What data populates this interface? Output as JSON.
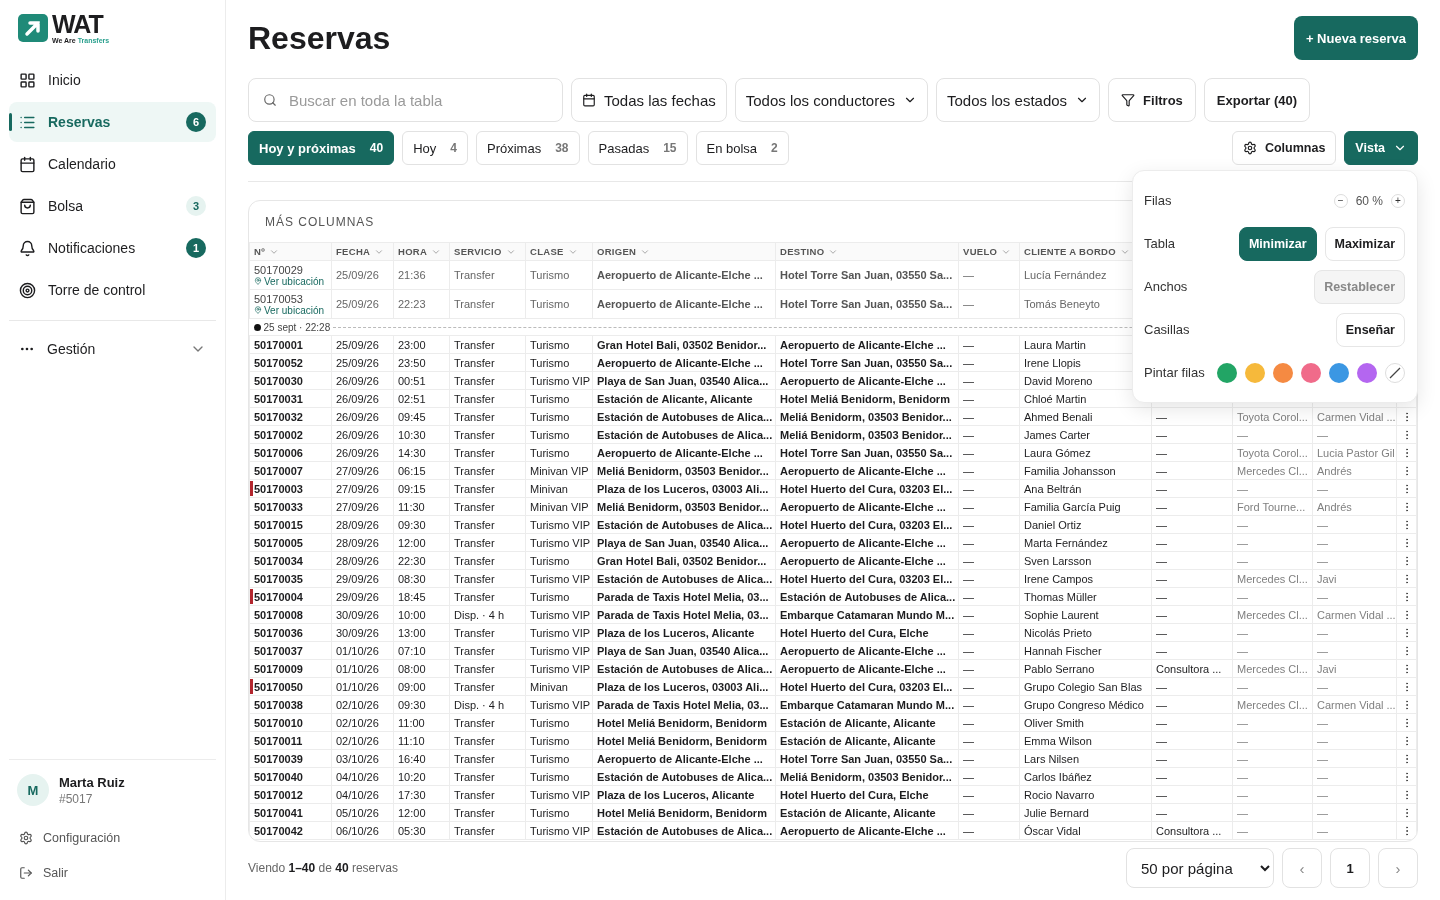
{
  "logo": {
    "name": "WAT",
    "tagline": "We Are",
    "tagline_accent": "Transfers"
  },
  "sidebar": {
    "items": [
      {
        "label": "Inicio",
        "selected": false
      },
      {
        "label": "Reservas",
        "selected": true,
        "badge": "6",
        "badge_highlighted": true
      },
      {
        "label": "Calendario",
        "selected": false
      },
      {
        "label": "Bolsa",
        "selected": false,
        "badge": "3",
        "badge_highlighted": false
      },
      {
        "label": "Notificaciones",
        "selected": false,
        "badge": "1",
        "badge_highlighted": true
      },
      {
        "label": "Torre de control",
        "selected": false
      }
    ],
    "section": {
      "label": "Gestión",
      "expanded": false
    },
    "user": {
      "initial": "M",
      "name": "Marta Ruiz",
      "id": "#5017"
    },
    "footer_links": [
      {
        "label": "Configuración"
      },
      {
        "label": "Salir"
      }
    ]
  },
  "title": "Reservas",
  "new_button": "+ Nueva reserva",
  "filters": {
    "search": {
      "placeholder": "Buscar en toda la tabla"
    },
    "dates": "Todas las fechas",
    "drivers": "Todos los conductores",
    "states": "Todos los estados",
    "more": "Filtros",
    "export": "Exportar (40)"
  },
  "tabs": [
    {
      "label": "Hoy y próximas",
      "count": "40",
      "selected": true
    },
    {
      "label": "Hoy",
      "count": "4",
      "selected": false
    },
    {
      "label": "Próximas",
      "count": "38",
      "selected": false
    },
    {
      "label": "Pasadas",
      "count": "15",
      "selected": false
    },
    {
      "label": "En bolsa",
      "count": "2",
      "selected": false
    }
  ],
  "columns_button": "Columnas",
  "view_button": "Vista",
  "view_panel": {
    "rows_label": "Filas",
    "minus": "−",
    "zoom": "60 %",
    "plus": "+",
    "table_label": "Tabla",
    "table_options": [
      {
        "label": "Minimizar",
        "selected": true
      },
      {
        "label": "Maximizar",
        "selected": false
      }
    ],
    "widths_label": "Anchos",
    "reset": "Restablecer",
    "reset_disabled": true,
    "boxes_label": "Casillas",
    "show": "Enseñar",
    "paint_label": "Pintar filas",
    "swatches": [
      {
        "kind": "color",
        "color": "#22a565"
      },
      {
        "kind": "color",
        "color": "#f6b93b"
      },
      {
        "kind": "color",
        "color": "#f58a42"
      },
      {
        "kind": "color",
        "color": "#f06b8a"
      },
      {
        "kind": "color",
        "color": "#3b97e3"
      },
      {
        "kind": "color",
        "color": "#b466f0"
      },
      {
        "kind": "none"
      }
    ]
  },
  "table": {
    "title": "MÁS COLUMNAS",
    "columns": [
      "Nº",
      "FECHA",
      "HORA",
      "SERVICIO",
      "CLASE",
      "ORIGEN",
      "DESTINO",
      "VUELO",
      "CLIENTE A BORDO"
    ],
    "pinned_rows": [
      {
        "cells": [
          "50170029",
          "25/09/26",
          "21:36",
          "Transfer",
          "Turismo",
          "Aeropuerto de Alicante-Elche ...",
          "Hotel Torre San Juan, 03550 Sa...",
          "—",
          "Lucía Fernández"
        ],
        "link": "Ver ubicación"
      },
      {
        "cells": [
          "50170053",
          "25/09/26",
          "22:23",
          "Transfer",
          "Turismo",
          "Aeropuerto de Alicante-Elche ...",
          "Hotel Torre San Juan, 03550 Sa...",
          "—",
          "Tomás Beneyto"
        ],
        "link": "Ver ubicación"
      }
    ],
    "now_marker": "25 sept · 22:28",
    "rows": [
      {
        "marked": false,
        "cells": [
          "50170001",
          "25/09/26",
          "23:00",
          "Transfer",
          "Turismo",
          "Gran Hotel Bali, 03502 Benidor...",
          "Aeropuerto de Alicante-Elche ...",
          "—",
          "Laura Martin"
        ]
      },
      {
        "marked": false,
        "cells": [
          "50170052",
          "25/09/26",
          "23:50",
          "Transfer",
          "Turismo",
          "Aeropuerto de Alicante-Elche ...",
          "Hotel Torre San Juan, 03550 Sa...",
          "—",
          "Irene Llopis"
        ]
      },
      {
        "marked": false,
        "cells": [
          "50170030",
          "26/09/26",
          "00:51",
          "Transfer",
          "Turismo VIP",
          "Playa de San Juan, 03540 Alica...",
          "Aeropuerto de Alicante-Elche ...",
          "—",
          "David Moreno"
        ]
      },
      {
        "marked": false,
        "cells": [
          "50170031",
          "26/09/26",
          "02:51",
          "Transfer",
          "Turismo",
          "Estación de Alicante, Alicante",
          "Hotel Meliá Benidorm, Benidorm",
          "—",
          "Chloé Martin"
        ]
      },
      {
        "marked": false,
        "cells": [
          "50170032",
          "26/09/26",
          "09:45",
          "Transfer",
          "Turismo",
          "Estación de Autobuses de Alica...",
          "Meliá Benidorm, 03503 Benidor...",
          "—",
          "Ahmed Benali"
        ],
        "extra": [
          "—",
          "Toyota Corol...",
          "Carmen Vidal ..."
        ]
      },
      {
        "marked": false,
        "cells": [
          "50170002",
          "26/09/26",
          "10:30",
          "Transfer",
          "Turismo",
          "Estación de Autobuses de Alica...",
          "Meliá Benidorm, 03503 Benidor...",
          "—",
          "James Carter"
        ],
        "extra": [
          "—",
          "—",
          "—"
        ]
      },
      {
        "marked": false,
        "cells": [
          "50170006",
          "26/09/26",
          "14:30",
          "Transfer",
          "Turismo",
          "Aeropuerto de Alicante-Elche ...",
          "Hotel Torre San Juan, 03550 Sa...",
          "—",
          "Laura Gómez"
        ],
        "extra": [
          "—",
          "Toyota Corol...",
          "Lucia Pastor Gil"
        ]
      },
      {
        "marked": false,
        "cells": [
          "50170007",
          "27/09/26",
          "06:15",
          "Transfer",
          "Minivan VIP",
          "Meliá Benidorm, 03503 Benidor...",
          "Aeropuerto de Alicante-Elche ...",
          "—",
          "Familia Johansson"
        ],
        "extra": [
          "—",
          "Mercedes Cl...",
          "Andrés"
        ]
      },
      {
        "marked": true,
        "cells": [
          "50170003",
          "27/09/26",
          "09:15",
          "Transfer",
          "Minivan",
          "Plaza de los Luceros, 03003 Ali...",
          "Hotel Huerto del Cura, 03203 El...",
          "—",
          "Ana Beltrán"
        ],
        "extra": [
          "—",
          "—",
          "—"
        ]
      },
      {
        "marked": false,
        "cells": [
          "50170033",
          "27/09/26",
          "11:30",
          "Transfer",
          "Minivan VIP",
          "Meliá Benidorm, 03503 Benidor...",
          "Aeropuerto de Alicante-Elche ...",
          "—",
          "Familia García Puig"
        ],
        "extra": [
          "—",
          "Ford Tourne...",
          "Andrés"
        ]
      },
      {
        "marked": false,
        "cells": [
          "50170015",
          "28/09/26",
          "09:30",
          "Transfer",
          "Turismo VIP",
          "Estación de Autobuses de Alica...",
          "Hotel Huerto del Cura, 03203 El...",
          "—",
          "Daniel Ortiz"
        ],
        "extra": [
          "—",
          "—",
          "—"
        ]
      },
      {
        "marked": false,
        "cells": [
          "50170005",
          "28/09/26",
          "12:00",
          "Transfer",
          "Turismo VIP",
          "Playa de San Juan, 03540 Alica...",
          "Aeropuerto de Alicante-Elche ...",
          "—",
          "Marta Fernández"
        ],
        "extra": [
          "—",
          "—",
          "—"
        ]
      },
      {
        "marked": false,
        "cells": [
          "50170034",
          "28/09/26",
          "22:30",
          "Transfer",
          "Turismo",
          "Gran Hotel Bali, 03502 Benidor...",
          "Aeropuerto de Alicante-Elche ...",
          "—",
          "Sven Larsson"
        ],
        "extra": [
          "—",
          "—",
          "—"
        ]
      },
      {
        "marked": false,
        "cells": [
          "50170035",
          "29/09/26",
          "08:30",
          "Transfer",
          "Turismo VIP",
          "Estación de Autobuses de Alica...",
          "Hotel Huerto del Cura, 03203 El...",
          "—",
          "Irene Campos"
        ],
        "extra": [
          "—",
          "Mercedes Cl...",
          "Javi"
        ]
      },
      {
        "marked": true,
        "cells": [
          "50170004",
          "29/09/26",
          "18:45",
          "Transfer",
          "Turismo",
          "Parada de Taxis Hotel Melia, 03...",
          "Estación de Autobuses de Alica...",
          "—",
          "Thomas Müller"
        ],
        "extra": [
          "—",
          "—",
          "—"
        ]
      },
      {
        "marked": false,
        "cells": [
          "50170008",
          "30/09/26",
          "10:00",
          "Disp. · 4 h",
          "Turismo VIP",
          "Parada de Taxis Hotel Melia, 03...",
          "Embarque Catamaran Mundo M...",
          "—",
          "Sophie Laurent"
        ],
        "extra": [
          "—",
          "Mercedes Cl...",
          "Carmen Vidal ..."
        ]
      },
      {
        "marked": false,
        "cells": [
          "50170036",
          "30/09/26",
          "13:00",
          "Transfer",
          "Turismo VIP",
          "Plaza de los Luceros, Alicante",
          "Hotel Huerto del Cura, Elche",
          "—",
          "Nicolás Prieto"
        ],
        "extra": [
          "—",
          "—",
          "—"
        ]
      },
      {
        "marked": false,
        "cells": [
          "50170037",
          "01/10/26",
          "07:10",
          "Transfer",
          "Turismo VIP",
          "Playa de San Juan, 03540 Alica...",
          "Aeropuerto de Alicante-Elche ...",
          "—",
          "Hannah Fischer"
        ],
        "extra": [
          "—",
          "—",
          "—"
        ]
      },
      {
        "marked": false,
        "cells": [
          "50170009",
          "01/10/26",
          "08:00",
          "Transfer",
          "Turismo VIP",
          "Estación de Autobuses de Alica...",
          "Aeropuerto de Alicante-Elche ...",
          "—",
          "Pablo Serrano"
        ],
        "extra": [
          "Consultora ...",
          "Mercedes Cl...",
          "Javi"
        ]
      },
      {
        "marked": true,
        "cells": [
          "50170050",
          "01/10/26",
          "09:00",
          "Transfer",
          "Minivan",
          "Plaza de los Luceros, 03003 Ali...",
          "Hotel Huerto del Cura, 03203 El...",
          "—",
          "Grupo Colegio San Blas"
        ],
        "extra": [
          "—",
          "—",
          "—"
        ]
      },
      {
        "marked": false,
        "cells": [
          "50170038",
          "02/10/26",
          "09:30",
          "Disp. · 4 h",
          "Turismo VIP",
          "Parada de Taxis Hotel Melia, 03...",
          "Embarque Catamaran Mundo M...",
          "—",
          "Grupo Congreso Médico"
        ],
        "extra": [
          "—",
          "Mercedes Cl...",
          "Carmen Vidal ..."
        ]
      },
      {
        "marked": false,
        "cells": [
          "50170010",
          "02/10/26",
          "11:00",
          "Transfer",
          "Turismo",
          "Hotel Meliá Benidorm, Benidorm",
          "Estación de Alicante, Alicante",
          "—",
          "Oliver Smith"
        ],
        "extra": [
          "—",
          "—",
          "—"
        ]
      },
      {
        "marked": false,
        "cells": [
          "50170011",
          "02/10/26",
          "11:10",
          "Transfer",
          "Turismo",
          "Hotel Meliá Benidorm, Benidorm",
          "Estación de Alicante, Alicante",
          "—",
          "Emma Wilson"
        ],
        "extra": [
          "—",
          "—",
          "—"
        ]
      },
      {
        "marked": false,
        "cells": [
          "50170039",
          "03/10/26",
          "16:40",
          "Transfer",
          "Turismo",
          "Aeropuerto de Alicante-Elche ...",
          "Hotel Torre San Juan, 03550 Sa...",
          "—",
          "Lars Nilsen"
        ],
        "extra": [
          "—",
          "—",
          "—"
        ]
      },
      {
        "marked": false,
        "cells": [
          "50170040",
          "04/10/26",
          "10:20",
          "Transfer",
          "Turismo",
          "Estación de Autobuses de Alica...",
          "Meliá Benidorm, 03503 Benidor...",
          "—",
          "Carlos Ibáñez"
        ],
        "extra": [
          "—",
          "—",
          "—"
        ]
      },
      {
        "marked": false,
        "cells": [
          "50170012",
          "04/10/26",
          "17:30",
          "Transfer",
          "Turismo VIP",
          "Plaza de los Luceros, Alicante",
          "Hotel Huerto del Cura, Elche",
          "—",
          "Rocio Navarro"
        ],
        "extra": [
          "—",
          "—",
          "—"
        ]
      },
      {
        "marked": false,
        "cells": [
          "50170041",
          "05/10/26",
          "12:00",
          "Transfer",
          "Turismo",
          "Hotel Meliá Benidorm, Benidorm",
          "Estación de Alicante, Alicante",
          "—",
          "Julie Bernard"
        ],
        "extra": [
          "—",
          "—",
          "—"
        ]
      },
      {
        "marked": false,
        "cells": [
          "50170042",
          "06/10/26",
          "05:30",
          "Transfer",
          "Turismo VIP",
          "Estación de Autobuses de Alica...",
          "Aeropuerto de Alicante-Elche ...",
          "—",
          "Óscar Vidal"
        ],
        "extra": [
          "Consultora ...",
          "—",
          "—"
        ]
      }
    ]
  },
  "footer": {
    "summary": "Viendo **1–40** de **40** reservas",
    "page_size": "50 por página",
    "prev": "‹",
    "page": "1",
    "next": "›"
  }
}
